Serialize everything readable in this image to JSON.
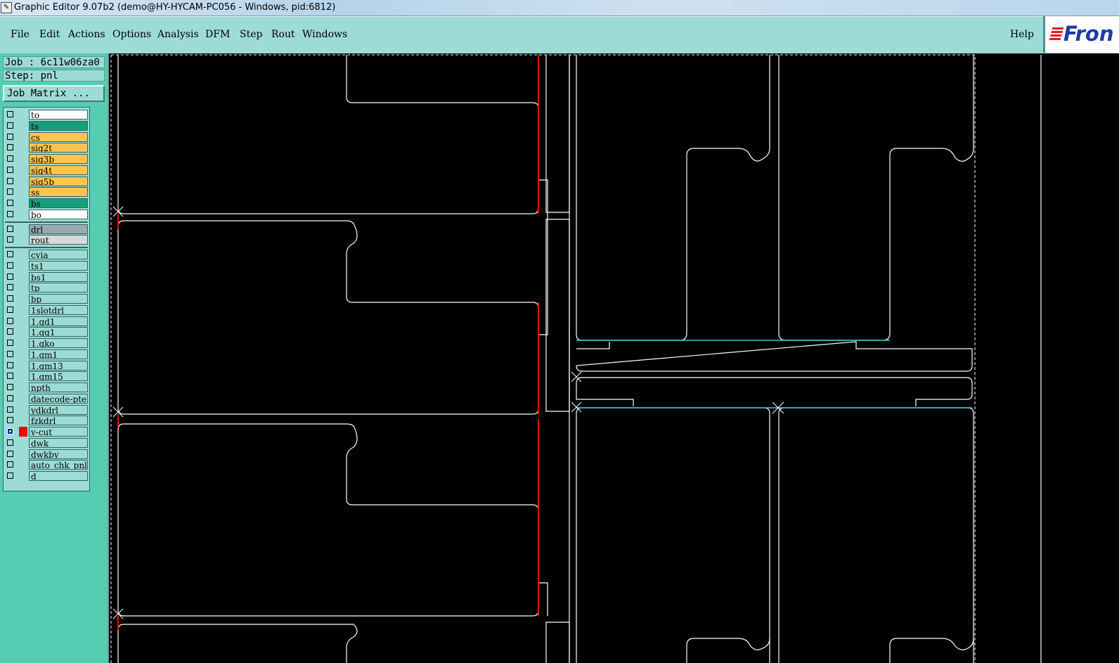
{
  "window": {
    "title": "Graphic Editor 9.07b2 (demo@HY-HYCAM-PC056 - Windows, pid:6812)"
  },
  "menubar": {
    "items": [
      "File",
      "Edit",
      "Actions",
      "Options",
      "Analysis",
      "DFM",
      "Step",
      "Rout",
      "Windows"
    ],
    "help": "Help"
  },
  "brand": {
    "text": "Fron"
  },
  "job_panel": {
    "job": "Job : 6c11w06za0",
    "step": "Step: pnl",
    "job_matrix_button": "Job Matrix ..."
  },
  "colors": {
    "white": "#ffffff",
    "green": "#16a07a",
    "orange": "#ffc44d",
    "gray": "#98aab0",
    "lightgray": "#d8d8d8",
    "cyan": "#9ddbd6",
    "board_outline": "#ffffff",
    "vcut_red": "#e01010",
    "cyan_line": "#29d1d9",
    "active_blue": "#0a1fa0",
    "active_red": "#ff0000"
  },
  "layers": {
    "group1": [
      {
        "name": "to",
        "color": "white"
      },
      {
        "name": "ts",
        "color": "green"
      },
      {
        "name": "cs",
        "color": "orange"
      },
      {
        "name": "sig2t",
        "color": "orange"
      },
      {
        "name": "sig3b",
        "color": "orange"
      },
      {
        "name": "sig4t",
        "color": "orange"
      },
      {
        "name": "sig5b",
        "color": "orange"
      },
      {
        "name": "ss",
        "color": "orange"
      },
      {
        "name": "bs",
        "color": "green"
      },
      {
        "name": "bo",
        "color": "white"
      }
    ],
    "group2": [
      {
        "name": "drl",
        "color": "gray"
      },
      {
        "name": "rout",
        "color": "lightgray"
      }
    ],
    "group3": [
      {
        "name": "cvia",
        "color": "cyan"
      },
      {
        "name": "ts1",
        "color": "cyan"
      },
      {
        "name": "bs1",
        "color": "cyan"
      },
      {
        "name": "tp",
        "color": "cyan"
      },
      {
        "name": "bp",
        "color": "cyan"
      },
      {
        "name": "1slotdrl",
        "color": "cyan"
      },
      {
        "name": "1.gd1",
        "color": "cyan"
      },
      {
        "name": "1.gg1",
        "color": "cyan"
      },
      {
        "name": "1.gko",
        "color": "cyan"
      },
      {
        "name": "1.gm1",
        "color": "cyan"
      },
      {
        "name": "1.gm13",
        "color": "cyan"
      },
      {
        "name": "1.gm15",
        "color": "cyan"
      },
      {
        "name": "npth",
        "color": "cyan"
      },
      {
        "name": "datecode-pte",
        "color": "cyan"
      },
      {
        "name": "ydkdrl",
        "color": "cyan"
      },
      {
        "name": "fzkdrl",
        "color": "cyan"
      },
      {
        "name": "v-cut",
        "color": "cyan",
        "active": true
      },
      {
        "name": "dwk",
        "color": "cyan"
      },
      {
        "name": "dwkby",
        "color": "cyan"
      },
      {
        "name": "auto_chk_pnl",
        "color": "cyan"
      },
      {
        "name": "d",
        "color": "cyan"
      }
    ]
  }
}
